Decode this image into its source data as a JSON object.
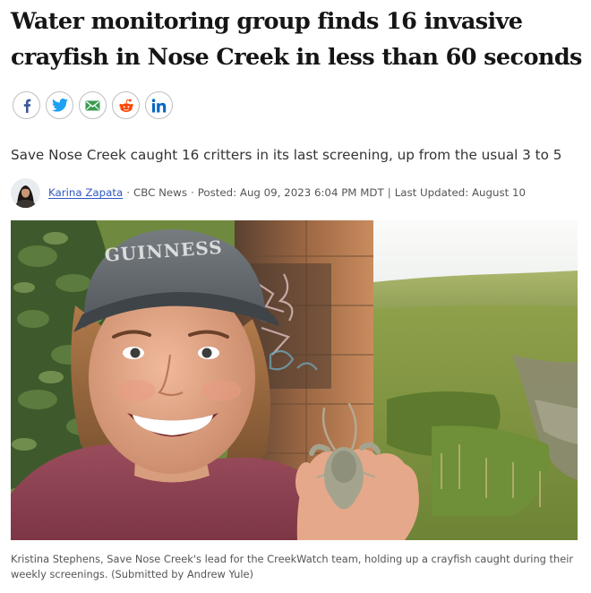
{
  "article": {
    "headline": "Water monitoring group finds 16 invasive crayfish in Nose Creek in less than 60 seconds",
    "deck": "Save Nose Creek caught 16 critters in its last screening, up from the usual 3 to 5"
  },
  "share": [
    {
      "icon": "facebook-icon",
      "color": "#3b5998"
    },
    {
      "icon": "twitter-icon",
      "color": "#1da1f2"
    },
    {
      "icon": "email-icon",
      "color": "#3b9b50"
    },
    {
      "icon": "reddit-icon",
      "color": "#ff4500"
    },
    {
      "icon": "linkedin-icon",
      "color": "#0a66c2"
    }
  ],
  "byline": {
    "author": "Karina Zapata",
    "outlet": "CBC News",
    "posted": "Posted: Aug 09, 2023 6:04 PM MDT",
    "updated": "Last Updated: August 10",
    "dot": "·",
    "pipe": "|"
  },
  "photo": {
    "cap_text": "GUINNESS",
    "caption": "Kristina Stephens, Save Nose Creek's lead for the CreekWatch team, holding up a crayfish caught during their weekly screenings. (Submitted by Andrew Yule)"
  }
}
